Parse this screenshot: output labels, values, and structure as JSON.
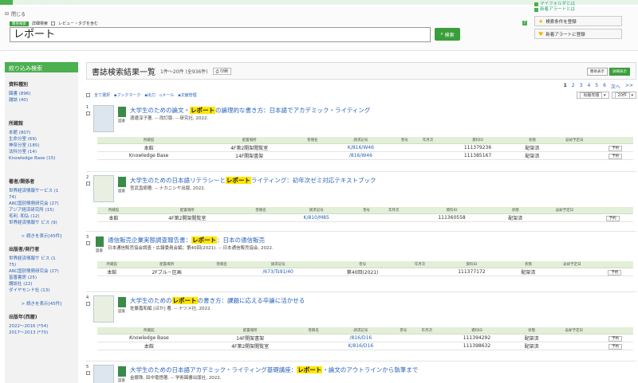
{
  "tabs": [
    "",
    "",
    "",
    "",
    ""
  ],
  "toplinks": {
    "myfolder": "マイフォルダとは",
    "alert": "新着アラートとは",
    "save_cond": "検索条件を登録",
    "save_alert": "新着アラートに登録"
  },
  "search": {
    "close": "閉じる",
    "mode_simple": "簡易検索",
    "mode_detail": "詳細検索",
    "review_opt": "レビュー・タグを含む",
    "query": "レポート",
    "button": "検索",
    "help": "?"
  },
  "sidebar": {
    "header": "絞り込み検索",
    "sections": [
      {
        "title": "資料種別",
        "items": [
          "図書 (896)",
          "雑誌 (40)"
        ],
        "more": ""
      },
      {
        "title": "所蔵館",
        "items": [
          "本館 (807)",
          "生命分室 (69)",
          "神奈分室 (185)",
          "法科分室 (14)",
          "Knowledge Base (15)"
        ],
        "more": ""
      },
      {
        "title": "著者/関係者",
        "items": [
          "世界経済情報サービス (1",
          "74)",
          "ARC国別情勢研究会 (27)",
          "アジア経済研究所 (15)",
          "毛利, 和弘 (12)",
          "世界経済情報サ ビス (9)"
        ],
        "more": "> 続きを表示[45件]"
      },
      {
        "title": "出版者/発行者",
        "items": [
          "世界経済情報サ ビス (1",
          "75)",
          "ARC国別情勢研究会 (27)",
          "富善書房 (25)",
          "講談社 (22)",
          "ダイヤモンド社 (13)"
        ],
        "more": "> 続きを表示[45件]"
      },
      {
        "title": "出版年(西暦)",
        "items": [
          "2022～2016 (*54)",
          "2017～2013 (*70)"
        ],
        "more": ""
      }
    ]
  },
  "main": {
    "title": "書誌検索結果一覧",
    "count": "1件～20件 (全936件)",
    "print": "印刷",
    "view_simple": "簡易表示",
    "view_detail": "詳細表示",
    "pages": [
      "1",
      "2",
      "3",
      "4",
      "5",
      "6",
      "次へ",
      ">>"
    ],
    "toolbar": [
      "全て選択",
      "ブックマーク",
      "出力",
      "メール",
      "文献管理"
    ],
    "sort": "出版年順",
    "per_page": "20件",
    "col_headers": [
      "所蔵館",
      "配置場所",
      "巻冊名",
      "請求記号",
      "巻号",
      "年月次",
      "資料ID",
      "状態",
      "返却予定日",
      ""
    ]
  },
  "records": [
    {
      "num": "1",
      "title_pre": "大学生のための論文・",
      "title_hl": "レポート",
      "title_post": "の論理的な書き方：日本語でアカデミック・ライティング",
      "meta": "渡邊淳子著. -- 改訂版. -- 研究社, 2022.",
      "book": "図書",
      "rows": [
        [
          "本館",
          "4F第2開架閲覧室",
          "",
          "K/816/W46",
          "",
          "",
          "111379236",
          "配架済",
          "",
          "予約"
        ],
        [
          "Knowledge Base",
          "14F開架書架",
          "",
          "/816/W46",
          "",
          "",
          "111385167",
          "配架済",
          "",
          "予約"
        ]
      ]
    },
    {
      "num": "2",
      "title_pre": "大学生のための日本語リテラシーと",
      "title_hl": "レポート",
      "title_post": "ライティング：初年次ゼミ対応テキストブック",
      "meta": "宮武直樹著. -- ナカニシヤ出版, 2022.",
      "book": "図書",
      "rows": [
        [
          "本館",
          "4F第2開架閲覧室",
          "",
          "K/810/M85",
          "",
          "",
          "111360558",
          "配架済",
          "",
          "予約"
        ]
      ]
    },
    {
      "num": "3",
      "title_pre": "通信販売企業実態調査報告書：",
      "title_hl": "レポート",
      "title_post": "：日本の通信販売",
      "meta": "日本通信販売協会調査・広報委員会編；第40回(2021). -- 日本通信販売協会, 2022.",
      "book": "図書",
      "rows": [
        [
          "本館",
          "2Fブル－区画",
          "",
          "/673/Ts91/40",
          "第40回(2021)",
          "",
          "111377172",
          "配架済",
          "",
          "予約"
        ]
      ]
    },
    {
      "num": "4",
      "title_pre": "大学生のための",
      "title_hl": "レポート",
      "title_post": "の書き方：課題に応える卒論に活かせる",
      "meta": "佐藤嘉和編 [ほか] 著. -- ナツメ社, 2022.",
      "book": "図書",
      "rows": [
        [
          "Knowledge Base",
          "14F開架書架",
          "",
          "/816/D16",
          "",
          "",
          "111394292",
          "配架済",
          "",
          "予約"
        ],
        [
          "本館",
          "4F第2開架閲覧室",
          "",
          "K/816/D16",
          "",
          "",
          "111398632",
          "配架済",
          "",
          "予約"
        ]
      ]
    },
    {
      "num": "5",
      "title_pre": "大学生のための日本語アカデミック・ライティング基礎講座：",
      "title_hl": "レポート",
      "title_post": "・論文のアウトラインから執筆まで",
      "meta": "金銀珠, 田中竜悟著. -- 学術図書出版社, 2022.",
      "book": "図書",
      "rows": []
    }
  ]
}
